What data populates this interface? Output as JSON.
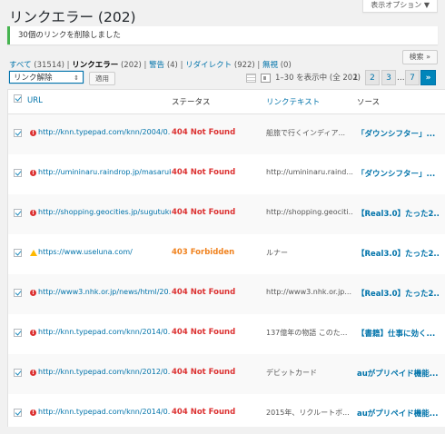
{
  "header": {
    "title": "リンクエラー (202)",
    "screen_options": "表示オプション ▼"
  },
  "notice": "30個のリンクを削除しました",
  "filters": [
    {
      "label": "すべて",
      "count": "(31514)",
      "current": false
    },
    {
      "label": "リンクエラー",
      "count": "(202)",
      "current": true
    },
    {
      "label": "警告",
      "count": "(4)",
      "current": false
    },
    {
      "label": "リダイレクト",
      "count": "(922)",
      "current": false
    },
    {
      "label": "無視",
      "count": "(0)",
      "current": false
    }
  ],
  "search_button": "検索 »",
  "bulk": {
    "selected": "リンク解除",
    "apply": "適用"
  },
  "pagination": {
    "displaying": "1–30 を表示中 (全 202)",
    "current_page": "1",
    "pages": [
      "2",
      "3"
    ],
    "ellipsis": "...",
    "last": "7",
    "next": "»"
  },
  "columns": {
    "url": "URL",
    "status": "ステータス",
    "link_text": "リンクテキスト",
    "source": "ソース"
  },
  "rows": [
    {
      "url": "http://knn.typepad.com/knn/2004/0...",
      "status": "404 Not Found",
      "link_text": "船旅で行くインディア...",
      "source": "「ダウンシフター」...",
      "level": "error"
    },
    {
      "url": "http://umininaru.raindrop.jp/masaruk...",
      "status": "404 Not Found",
      "link_text": "http://umininaru.raind...",
      "source": "「ダウンシフター」...",
      "level": "error"
    },
    {
      "url": "http://shopping.geocities.jp/sugutuku/",
      "status": "404 Not Found",
      "link_text": "http://shopping.geociti...",
      "source": "【Real3.0】たった2...",
      "level": "error"
    },
    {
      "url": "https://www.useluna.com/",
      "status": "403 Forbidden",
      "link_text": "ルナー",
      "source": "【Real3.0】たった2...",
      "level": "warning"
    },
    {
      "url": "http://www3.nhk.or.jp/news/html/20...",
      "status": "404 Not Found",
      "link_text": "http://www3.nhk.or.jp...",
      "source": "【Real3.0】たった2...",
      "level": "error"
    },
    {
      "url": "http://knn.typepad.com/knn/2014/0...",
      "status": "404 Not Found",
      "link_text": "137億年の物語 このた...",
      "source": "【書籍】仕事に効く...",
      "level": "error"
    },
    {
      "url": "http://knn.typepad.com/knn/2012/0...",
      "status": "404 Not Found",
      "link_text": "デビットカード",
      "source": "auがプリペイド機能...",
      "level": "error"
    },
    {
      "url": "http://knn.typepad.com/knn/2014/0...",
      "status": "404 Not Found",
      "link_text": "2015年、リクルートボ...",
      "source": "auがプリペイド機能...",
      "level": "error"
    }
  ],
  "colors": {
    "error": "#dc3232",
    "warning": "#f0821e",
    "link": "#0073aa",
    "notice_border": "#46b450"
  }
}
